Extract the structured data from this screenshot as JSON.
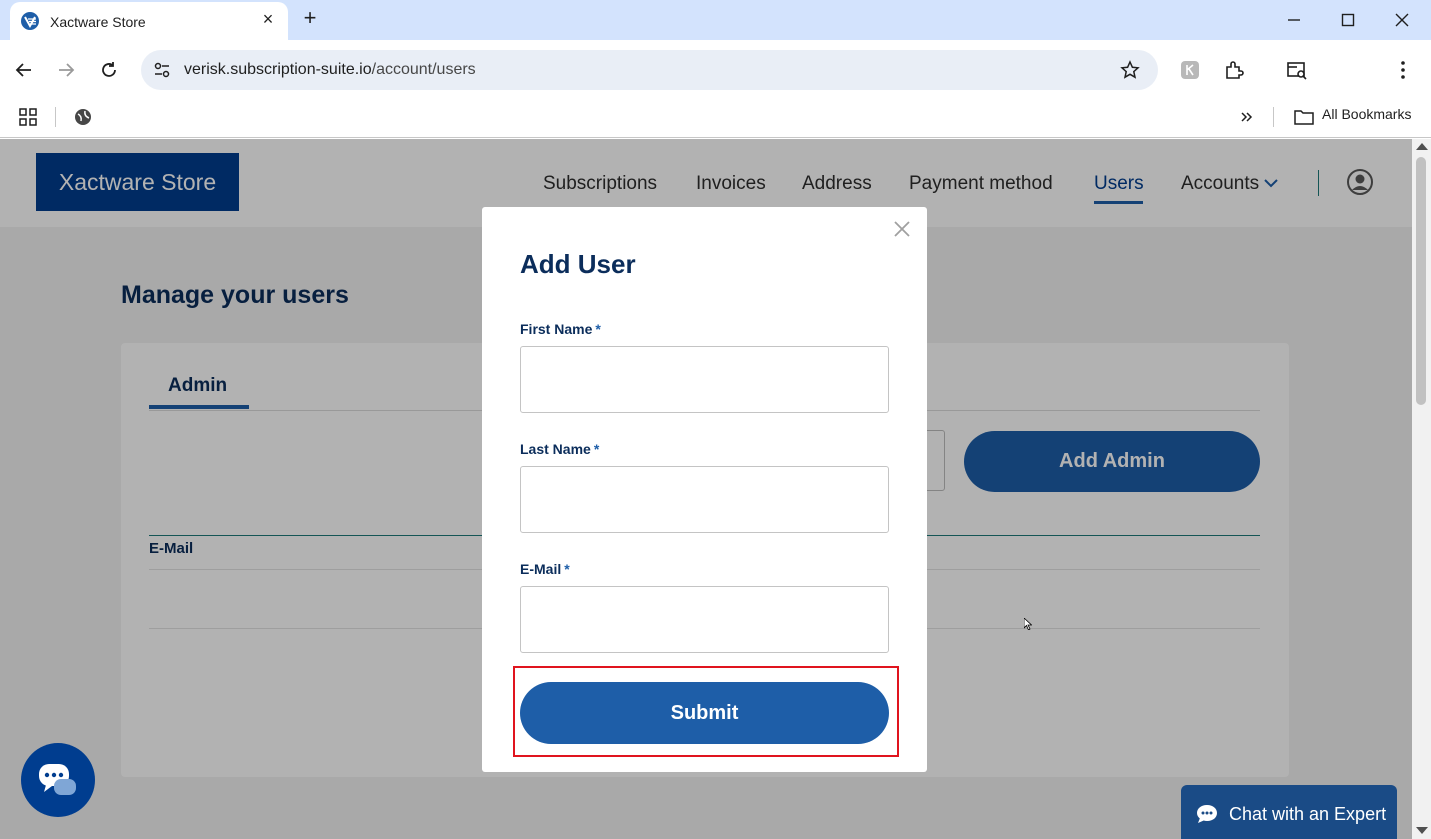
{
  "browser": {
    "tab_title": "Xactware Store",
    "url_host": "verisk.subscription-suite.io",
    "url_path": "/account/users",
    "bookmarks_label": "All Bookmarks"
  },
  "site": {
    "logo": "Xactware Store",
    "nav": {
      "subscriptions": "Subscriptions",
      "invoices": "Invoices",
      "address": "Address",
      "payment_method": "Payment method",
      "users": "Users",
      "accounts": "Accounts"
    }
  },
  "main": {
    "title": "Manage your users",
    "tab": "Admin",
    "add_admin": "Add Admin",
    "email_header": "E-Mail"
  },
  "modal": {
    "title": "Add User",
    "first_name": "First Name",
    "last_name": "Last Name",
    "email": "E-Mail",
    "required_mark": "*",
    "submit": "Submit"
  },
  "chat": {
    "expert_label": "Chat with an Expert"
  },
  "colors": {
    "brand": "#003d8f",
    "primary_button": "#1e5ea8",
    "heading": "#0b2d5b",
    "highlight": "#e0141e"
  }
}
